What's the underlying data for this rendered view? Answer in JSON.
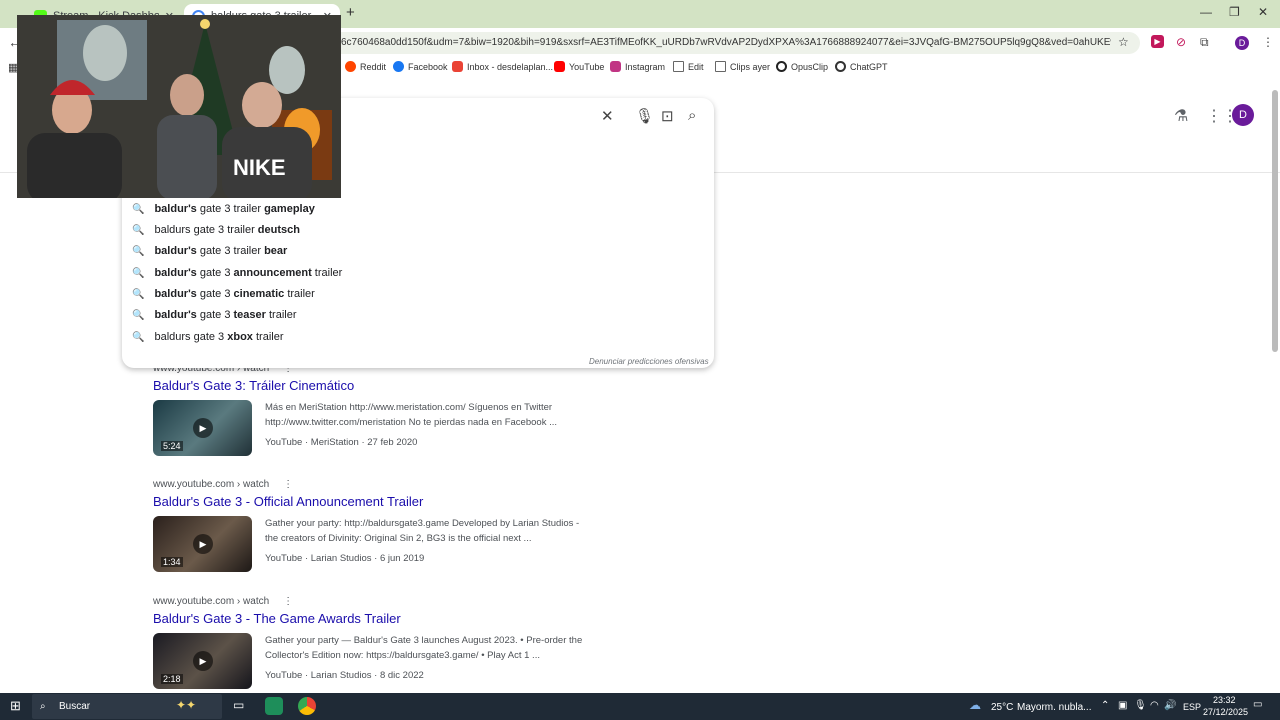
{
  "tabs": [
    {
      "title": "Stream - Kick Dashboard",
      "color": "#53fc18"
    },
    {
      "title": "baldurs gate 3 trailer - Buscar",
      "color": "#4285f4"
    }
  ],
  "address": {
    "url": "6c760468a0dd150f&udm=7&biw=1920&bih=919&sxsrf=AE3TifMEofKK_uURDb7wRVdvAP2DydXPXA%3A1766888924077&ei=3JVQafG-BM275OUP5lq9gQ8&ved=0ahUKEwjxnLWVnt-R..."
  },
  "profile_initial": "D",
  "bookmarks": [
    {
      "label": "Reddit",
      "color": "#ff4500"
    },
    {
      "label": "Facebook",
      "color": "#1877f2"
    },
    {
      "label": "Inbox - desdelaplan...",
      "color": "#ea4335"
    },
    {
      "label": "YouTube",
      "color": "#ff0000"
    },
    {
      "label": "Instagram",
      "color": "#c13584"
    },
    {
      "label": "Edit",
      "color": "#666666"
    },
    {
      "label": "Clips ayer",
      "color": "#666666"
    },
    {
      "label": "OpusClip",
      "color": "#222222"
    },
    {
      "label": "ChatGPT",
      "color": "#333333"
    }
  ],
  "suggestions": [
    {
      "pre": "baldur's",
      "mid": " gate 3 trailer ",
      "bold": "gameplay",
      "post": "",
      "pre_bold": true
    },
    {
      "pre": "baldurs gate 3 trailer ",
      "mid": "",
      "bold": "deutsch",
      "post": "",
      "pre_bold": false
    },
    {
      "pre": "baldur's",
      "mid": " gate 3 trailer ",
      "bold": "bear",
      "post": "",
      "pre_bold": true
    },
    {
      "pre": "baldur's",
      "mid": " gate 3 ",
      "bold": "announcement",
      "post": " trailer",
      "pre_bold": true
    },
    {
      "pre": "baldur's",
      "mid": " gate 3 ",
      "bold": "cinematic",
      "post": " trailer",
      "pre_bold": true
    },
    {
      "pre": "baldur's",
      "mid": " gate 3 ",
      "bold": "teaser",
      "post": " trailer",
      "pre_bold": true
    },
    {
      "pre": "baldurs gate 3 ",
      "mid": "",
      "bold": "xbox",
      "post": " trailer",
      "pre_bold": false
    }
  ],
  "report_text": "Denunciar predicciones ofensivas",
  "results": [
    {
      "cite": "www.youtube.com › watch",
      "title": "Baldur's Gate 3: Tráiler Cinemático",
      "duration": "5:24",
      "snippet_1": "Más en MeriStation http://www.meristation.com/ Síguenos en Twitter",
      "snippet_2": "http://www.twitter.com/meristation No te pierdas nada en Facebook ...",
      "meta": "YouTube · MeriStation · 27 feb 2020",
      "thumb_color": "#2f4a55"
    },
    {
      "cite": "www.youtube.com › watch",
      "title": "Baldur's Gate 3 - Official Announcement Trailer",
      "duration": "1:34",
      "snippet_1": "Gather your party: http://baldursgate3.game Developed by Larian Studios -",
      "snippet_2": "the creators of Divinity: Original Sin 2, BG3 is the official next ...",
      "meta": "YouTube · Larian Studios · 6 jun 2019",
      "thumb_color": "#3a2f2a"
    },
    {
      "cite": "www.youtube.com › watch",
      "title": "Baldur's Gate 3 - The Game Awards Trailer",
      "duration": "2:18",
      "snippet_1": "Gather your party — Baldur's Gate 3 launches August 2023. • Pre-order the",
      "snippet_2": "Collector's Edition now: https://baldursgate3.game/ • Play Act 1 ...",
      "meta": "YouTube · Larian Studios · 8 dic 2022",
      "thumb_color": "#2a2a33"
    }
  ],
  "taskbar": {
    "search": "Buscar",
    "weather": "25°C",
    "weather_desc": "Mayorm. nubla...",
    "lang": "ESP",
    "time": "23:32",
    "date": "27/12/2025"
  }
}
